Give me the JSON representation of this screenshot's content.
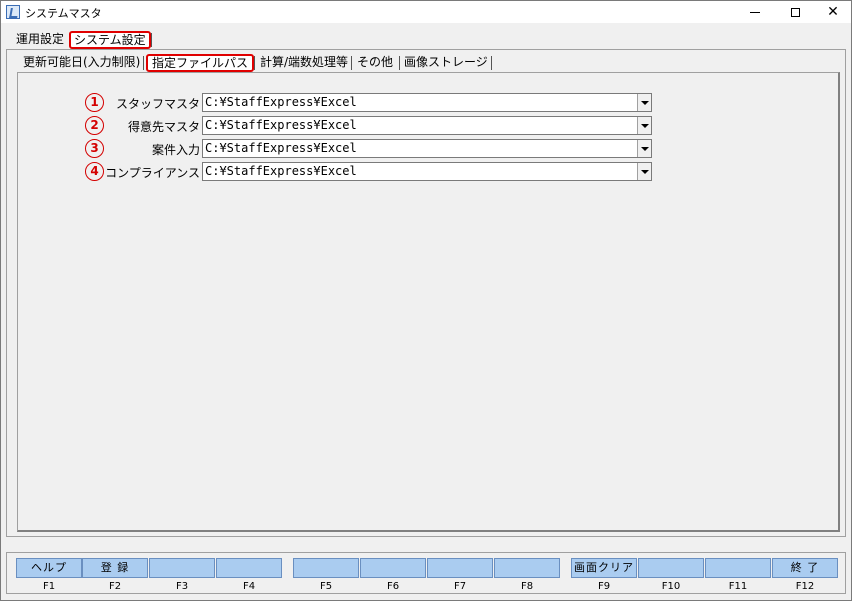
{
  "window": {
    "title": "システムマスタ",
    "minimize_icon": "minimize-icon",
    "maximize_icon": "maximize-icon",
    "close_icon": "close-icon",
    "close_glyph": "✕"
  },
  "outer_tabs": [
    {
      "label": "運用設定"
    },
    {
      "label": "システム設定",
      "selected": true
    }
  ],
  "inner_tabs": [
    {
      "label": "更新可能日(入力制限)"
    },
    {
      "label": "指定ファイルパス",
      "selected": true
    },
    {
      "label": "計算/端数処理等"
    },
    {
      "label": "その他"
    },
    {
      "label": "画像ストレージ"
    }
  ],
  "rows": [
    {
      "marker": "1",
      "label": "スタッフマスタ",
      "value": "C:¥StaffExpress¥Excel"
    },
    {
      "marker": "2",
      "label": "得意先マスタ",
      "value": "C:¥StaffExpress¥Excel"
    },
    {
      "marker": "3",
      "label": "案件入力",
      "value": "C:¥StaffExpress¥Excel"
    },
    {
      "marker": "4",
      "label": "コンプライアンス",
      "value": "C:¥StaffExpress¥Excel"
    }
  ],
  "fkeys": [
    {
      "label": "ヘルプ",
      "key": "F1"
    },
    {
      "label": "登 録",
      "key": "F2"
    },
    {
      "label": "",
      "key": "F3"
    },
    {
      "label": "",
      "key": "F4"
    },
    {
      "label": "",
      "key": "F5"
    },
    {
      "label": "",
      "key": "F6"
    },
    {
      "label": "",
      "key": "F7"
    },
    {
      "label": "",
      "key": "F8"
    },
    {
      "label": "画面クリア",
      "key": "F9"
    },
    {
      "label": "",
      "key": "F10"
    },
    {
      "label": "",
      "key": "F11"
    },
    {
      "label": "終 了",
      "key": "F12"
    }
  ],
  "colors": {
    "highlight": "#e00000",
    "fkey_bg": "#aaccf0"
  }
}
